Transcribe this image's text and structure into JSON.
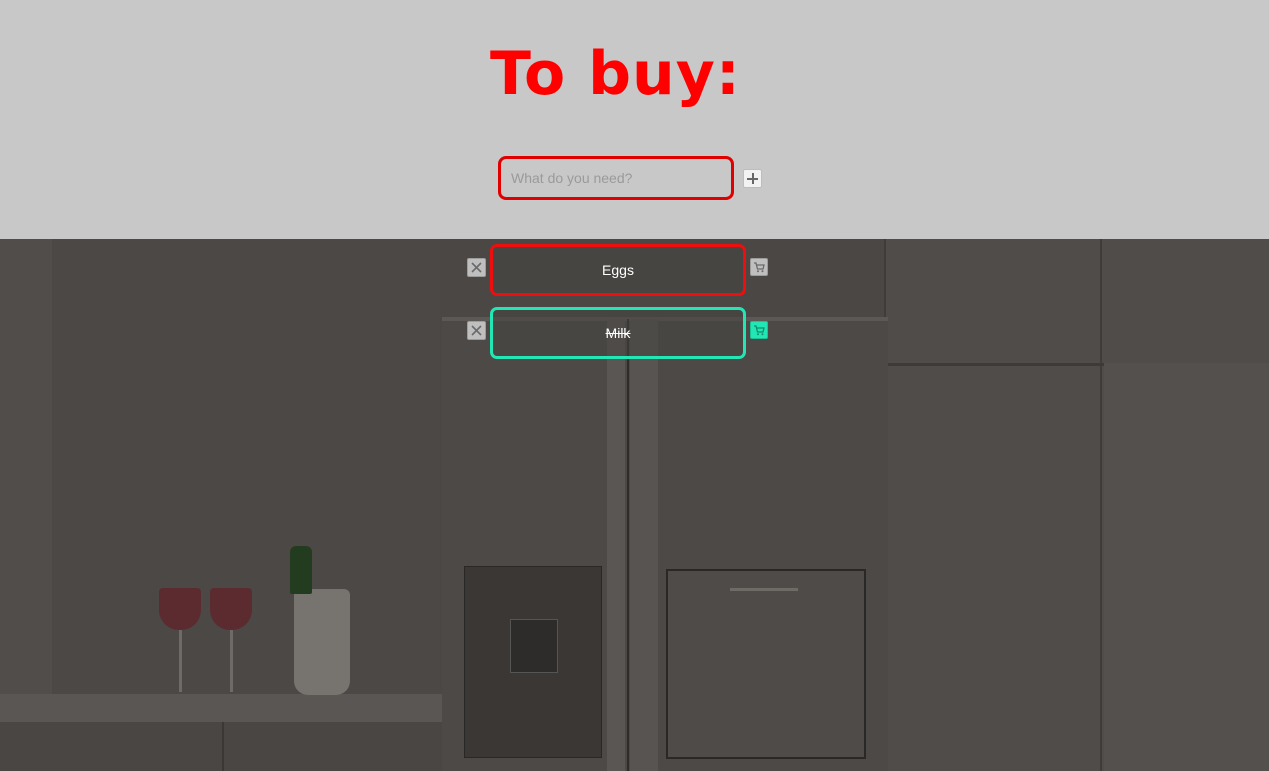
{
  "header": {
    "title": "To buy:"
  },
  "new_item": {
    "placeholder": "What do you need?",
    "value": ""
  },
  "items": [
    {
      "label": "Eggs",
      "bought": false
    },
    {
      "label": "Milk",
      "bought": true
    }
  ],
  "colors": {
    "header_background": "#c8c8c8",
    "title": "#ff0000",
    "pending_border": "#ee0e0e",
    "bought_border": "#22e6b4"
  },
  "icons": {
    "add": "plus-icon",
    "delete": "close-icon",
    "bought_toggle": "cart-icon"
  }
}
